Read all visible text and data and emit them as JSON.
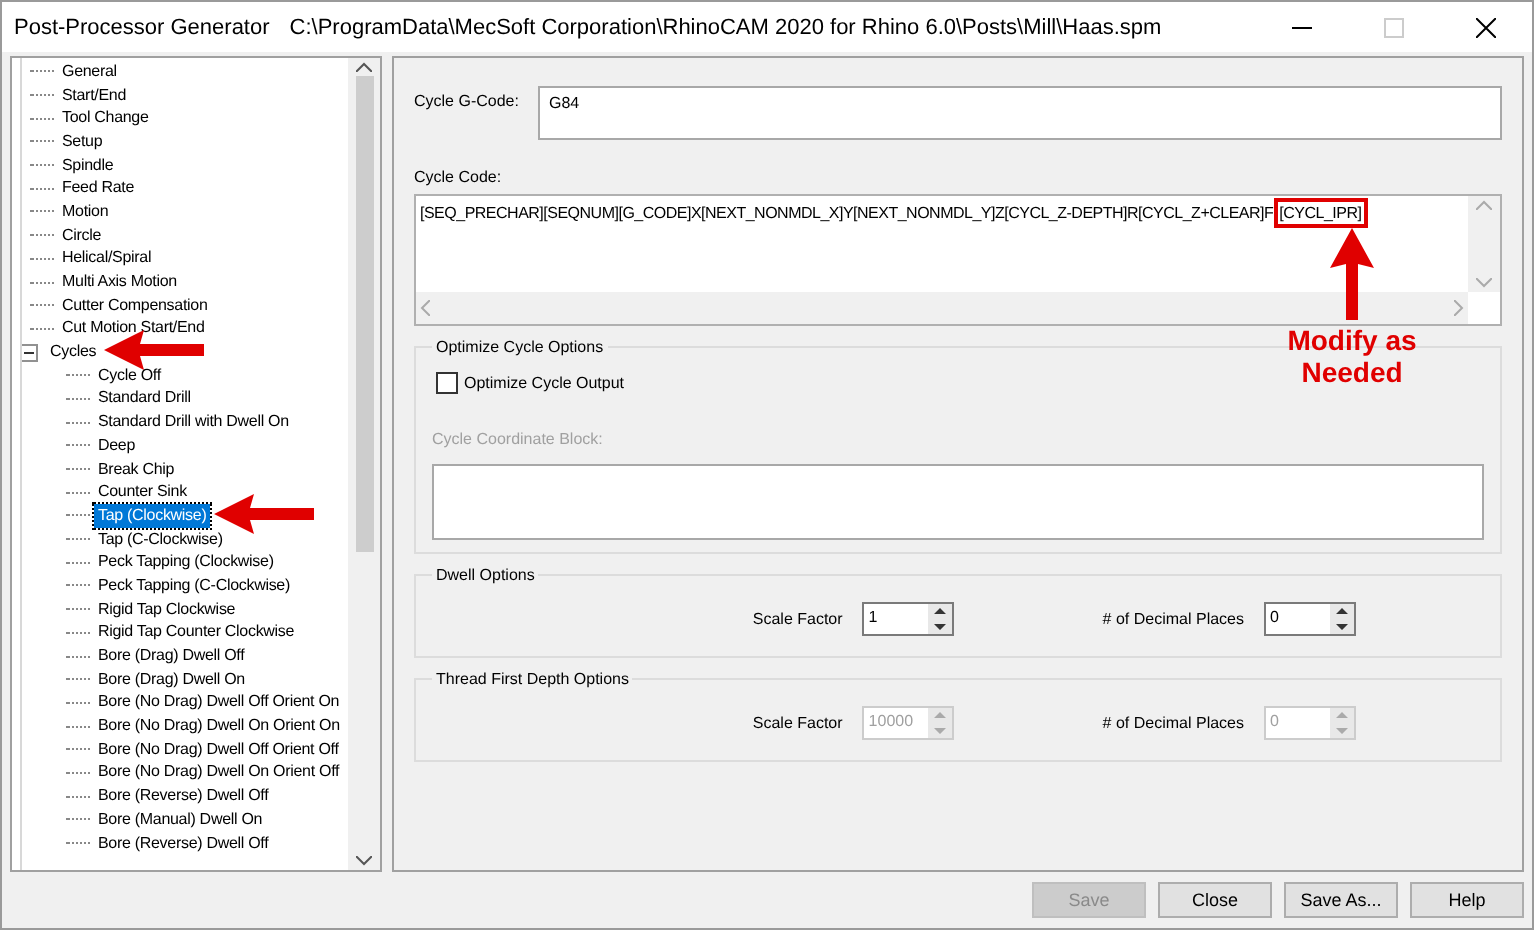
{
  "window": {
    "title": "Post-Processor Generator",
    "path": "C:\\ProgramData\\MecSoft Corporation\\RhinoCAM 2020 for Rhino 6.0\\Posts\\Mill\\Haas.spm"
  },
  "tree": {
    "items": [
      {
        "label": "General",
        "selected": false,
        "arrow": false
      },
      {
        "label": "Start/End",
        "selected": false,
        "arrow": false
      },
      {
        "label": "Tool Change",
        "selected": false,
        "arrow": false
      },
      {
        "label": "Setup",
        "selected": false,
        "arrow": false
      },
      {
        "label": "Spindle",
        "selected": false,
        "arrow": false
      },
      {
        "label": "Feed Rate",
        "selected": false,
        "arrow": false
      },
      {
        "label": "Motion",
        "selected": false,
        "arrow": false
      },
      {
        "label": "Circle",
        "selected": false,
        "arrow": false
      },
      {
        "label": "Helical/Spiral",
        "selected": false,
        "arrow": false
      },
      {
        "label": "Multi Axis Motion",
        "selected": false,
        "arrow": false
      },
      {
        "label": "Cutter Compensation",
        "selected": false,
        "arrow": false
      },
      {
        "label": "Cut Motion Start/End",
        "selected": false,
        "arrow": false
      },
      {
        "label": "Cycles",
        "selected": false,
        "arrow": true,
        "expanded": true,
        "children": [
          {
            "label": "Cycle Off",
            "selected": false,
            "arrow": false
          },
          {
            "label": "Standard Drill",
            "selected": false,
            "arrow": false
          },
          {
            "label": "Standard Drill with Dwell On",
            "selected": false,
            "arrow": false
          },
          {
            "label": "Deep",
            "selected": false,
            "arrow": false
          },
          {
            "label": "Break Chip",
            "selected": false,
            "arrow": false
          },
          {
            "label": "Counter Sink",
            "selected": false,
            "arrow": false
          },
          {
            "label": "Tap (Clockwise)",
            "selected": true,
            "arrow": true
          },
          {
            "label": "Tap (C-Clockwise)",
            "selected": false,
            "arrow": false
          },
          {
            "label": "Peck Tapping (Clockwise)",
            "selected": false,
            "arrow": false
          },
          {
            "label": "Peck Tapping (C-Clockwise)",
            "selected": false,
            "arrow": false
          },
          {
            "label": "Rigid Tap Clockwise",
            "selected": false,
            "arrow": false
          },
          {
            "label": "Rigid Tap Counter Clockwise",
            "selected": false,
            "arrow": false
          },
          {
            "label": "Bore (Drag) Dwell Off",
            "selected": false,
            "arrow": false
          },
          {
            "label": "Bore (Drag) Dwell On",
            "selected": false,
            "arrow": false
          },
          {
            "label": "Bore (No Drag) Dwell Off Orient On",
            "selected": false,
            "arrow": false
          },
          {
            "label": "Bore (No Drag) Dwell On Orient On",
            "selected": false,
            "arrow": false
          },
          {
            "label": "Bore (No Drag) Dwell Off Orient Off",
            "selected": false,
            "arrow": false
          },
          {
            "label": "Bore (No Drag) Dwell On Orient Off",
            "selected": false,
            "arrow": false
          },
          {
            "label": "Bore (Reverse) Dwell Off",
            "selected": false,
            "arrow": false
          },
          {
            "label": "Bore (Manual) Dwell On",
            "selected": false,
            "arrow": false
          },
          {
            "label": "Bore (Reverse) Dwell Off",
            "selected": false,
            "arrow": false
          }
        ]
      }
    ]
  },
  "gcode": {
    "label": "Cycle G-Code:",
    "value": "G84"
  },
  "cycle_code": {
    "label": "Cycle Code:",
    "text": "[SEQ_PRECHAR][SEQNUM][G_CODE]X[NEXT_NONMDL_X]Y[NEXT_NONMDL_Y]Z[CYCL_Z-DEPTH]R[CYCL_Z+CLEAR]F",
    "highlighted": "[CYCL_IPR]"
  },
  "annotation": "Modify as Needed",
  "optimize": {
    "title": "Optimize Cycle Options",
    "checkbox": {
      "label": "Optimize Cycle Output",
      "checked": false
    },
    "block": {
      "label": "Cycle Coordinate Block:",
      "disabled": true
    }
  },
  "spinner_groups": [
    {
      "title": "Dwell Options",
      "spinners": [
        {
          "label": "Scale Factor",
          "value": "1",
          "disabled": false
        },
        {
          "label": "# of Decimal Places",
          "value": "0",
          "disabled": false
        }
      ]
    },
    {
      "title": "Thread First Depth Options",
      "spinners": [
        {
          "label": "Scale Factor",
          "value": "10000",
          "disabled": true
        },
        {
          "label": "# of Decimal Places",
          "value": "0",
          "disabled": true
        }
      ]
    }
  ],
  "buttons": [
    {
      "label": "Save",
      "disabled": true
    },
    {
      "label": "Close",
      "disabled": false
    },
    {
      "label": "Save As...",
      "disabled": false
    },
    {
      "label": "Help",
      "disabled": false
    }
  ]
}
